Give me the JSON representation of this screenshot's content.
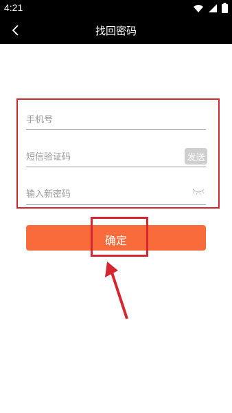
{
  "status": {
    "time": "4:21"
  },
  "nav": {
    "title": "找回密码"
  },
  "form": {
    "phone_placeholder": "手机号",
    "sms_placeholder": "短信验证码",
    "send_label": "发送",
    "password_placeholder": "输入新密码"
  },
  "actions": {
    "confirm_label": "确定"
  },
  "colors": {
    "accent": "#fa6b3b",
    "annotation_red": "#d6262f",
    "nav_bg": "#000000"
  },
  "icons": [
    "back-arrow-icon",
    "wifi-icon",
    "signal-icon",
    "battery-icon",
    "eye-closed-icon",
    "annotation-arrow-icon"
  ]
}
